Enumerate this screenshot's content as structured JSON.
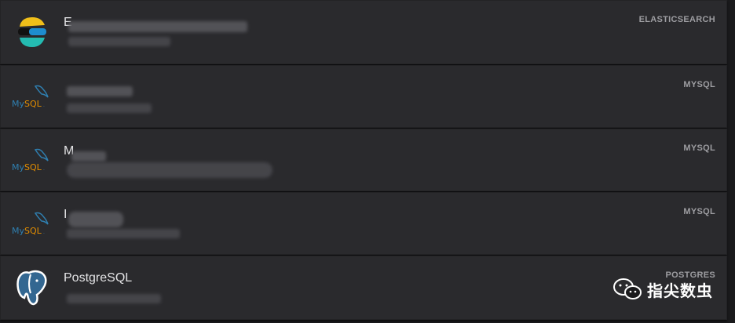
{
  "connections": [
    {
      "title": "E",
      "type": "ELASTICSEARCH",
      "logo": "elasticsearch-logo"
    },
    {
      "title": "",
      "type": "MYSQL",
      "logo": "mysql-logo"
    },
    {
      "title": "M",
      "type": "MYSQL",
      "logo": "mysql-logo"
    },
    {
      "title": "I",
      "type": "MYSQL",
      "logo": "mysql-logo"
    },
    {
      "title": "PostgreSQL",
      "type": "POSTGRES",
      "logo": "postgres-logo"
    }
  ],
  "watermark": {
    "text": "指尖数虫",
    "icon": "wechat-icon"
  },
  "colors": {
    "background": "#1a1a1c",
    "row": "#2a2a2d",
    "title": "#e4e4e6",
    "type": "#9d9da1",
    "mysql_blue": "#2f7fb0",
    "mysql_orange": "#e48e00",
    "postgres_blue": "#336791",
    "elastic_yellow": "#f0bf1a",
    "elastic_teal": "#24bbb1"
  }
}
